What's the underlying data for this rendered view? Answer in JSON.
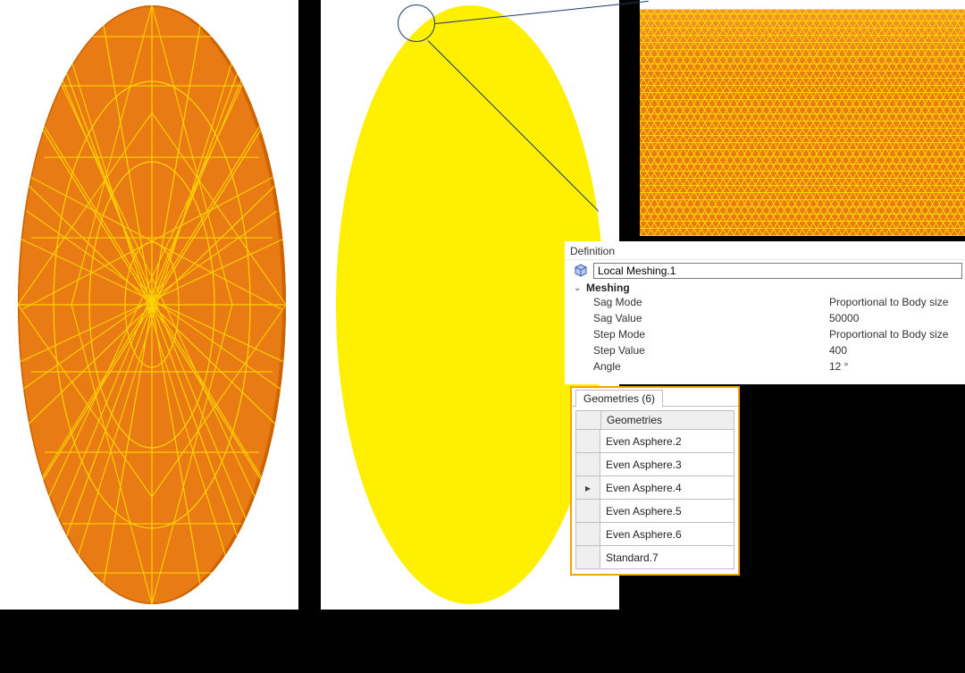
{
  "definition": {
    "header": "Definition",
    "name": "Local Meshing.1",
    "group_label": "Meshing",
    "props": [
      {
        "k": "Sag Mode",
        "v": "Proportional to Body size"
      },
      {
        "k": "Sag Value",
        "v": "50000"
      },
      {
        "k": "Step Mode",
        "v": "Proportional to Body size"
      },
      {
        "k": "Step Value",
        "v": "400"
      },
      {
        "k": "Angle",
        "v": "12 °"
      }
    ]
  },
  "geometries": {
    "tab_label": "Geometries (6)",
    "column_header": "Geometries",
    "active_row_index": 2,
    "rows": [
      "Even Asphere.2",
      "Even Asphere.3",
      "Even Asphere.4",
      "Even Asphere.5",
      "Even Asphere.6",
      "Standard.7"
    ]
  },
  "colors": {
    "mesh_fill": "#e87b13",
    "mesh_line": "#ffd400",
    "fine_mesh_fill": "#ffef00",
    "highlight_border": "#f5a300"
  }
}
